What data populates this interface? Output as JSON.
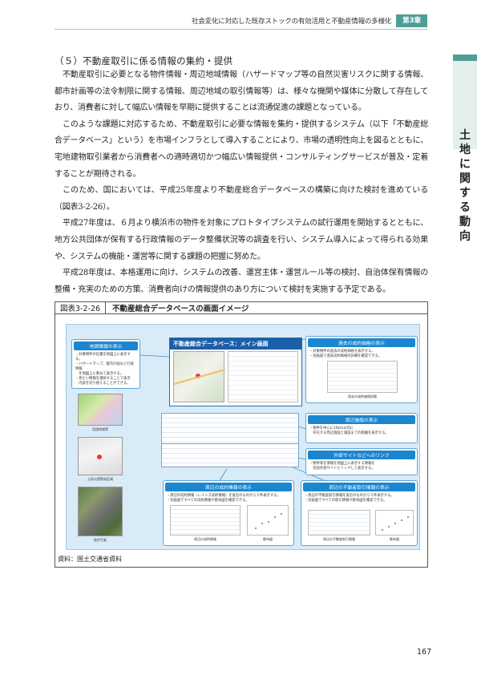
{
  "header": {
    "running_title": "社会変化に対応した既存ストックの有効活用と不動産情報の多様化",
    "chapter": "第3章"
  },
  "side_tab": {
    "chars": [
      "土",
      "地",
      "に",
      "関",
      "す",
      "る",
      "動",
      "向"
    ]
  },
  "section": {
    "title": "（５）不動産取引に係る情報の集約・提供",
    "paragraphs": [
      "不動産取引に必要となる物件情報・周辺地域情報（ハザードマップ等の自然災害リスクに関する情報、都市計画等の法令制限に関する情報、周辺地域の取引情報等）は、様々な機関や媒体に分散して存在しており、消費者に対して幅広い情報を早期に提供することは流通促進の課題となっている。",
      "このような課題に対応するため、不動産取引に必要な情報を集約・提供するシステム（以下「不動産総合データベース」という）を市場インフラとして導入することにより、市場の透明性向上を図るとともに、宅地建物取引業者から消費者への適時適切かつ幅広い情報提供・コンサルティングサービスが普及・定着することが期待される。",
      "このため、国においては、平成25年度より不動産総合データベースの構築に向けた検討を進めている（図表3-2-26）。",
      "平成27年度は、６月より横浜市の物件を対象にプロトタイプシステムの試行運用を開始するとともに、地方公共団体が保有する行政情報のデータ整備状況等の調査を行い、システム導入によって得られる効果や、システムの機能・運営等に関する課題の把握に努めた。",
      "平成28年度は、本格運用に向け、システムの改善、運営主体・運営ルール等の検討、自治体保有情報の整備・充実のための方策、消費者向けの情報提供のあり方について検討を実施する予定である。"
    ]
  },
  "figure": {
    "number": "図表3-2-26",
    "caption": "不動産総合データベースの画面イメージ",
    "source": "資料：国土交通省資料",
    "main_screen_title": "不動産総合データベース：メイン画面",
    "callouts": {
      "map_info": {
        "title": "地図情報の表示",
        "body": [
          "・対象物件の位置を地図上に表示する。",
          "・ハザードマップ、都市計画など行政情報",
          "　を地図上に重ねて表示する。",
          "・見たい情報を選択することで表示",
          "　内容を切り替えることができる。"
        ]
      },
      "past_price": {
        "title": "過去の成約価格の表示",
        "body": [
          "・対象物件の過去の成約価格を表示する。",
          "・別画面で過去成約価格の詳細を確認できる。"
        ]
      },
      "facilities": {
        "title": "周辺施設の表示",
        "body": [
          "・物件を中心に10km以内に",
          "　存在する周辺施設と施設までの距離を表示する。"
        ]
      },
      "external_links": {
        "title": "外部サイトなどへのリンク",
        "body": [
          "・物件等を情報を地図上に表示する情報を",
          "　別途外部サイトとリンクして表示する。"
        ]
      },
      "nearby_sales": {
        "title": "周辺の成約情報の表示",
        "body": [
          "・周辺の成約情報（レインズ成約情報）を直近のものから５件表示する。",
          "・別画面ですべての成約情報や散布図を確認できる。"
        ]
      },
      "nearby_transactions": {
        "title": "周辺の不動産取引情報の表示",
        "body": [
          "・周辺の不動産取引情報を直近のものから５件表示する。",
          "・別画面ですべての取引情報や散布図を確認できる。"
        ]
      }
    },
    "image_captions": {
      "hazard": "用途地域等",
      "landslide": "土砂災害警戒区域",
      "past_detail": "過去の成約価格詳細",
      "sales_detail": "周辺の成約情報",
      "scatter1": "散布図",
      "transactions_detail": "周辺の不動産取引情報",
      "scatter2": "散布図",
      "aerial": "航空写真"
    }
  },
  "page_number": "167",
  "colors": {
    "accent": "#4e9e96",
    "diagram_bg": "#d8ebf7",
    "callout_title": "#1b86cf",
    "main_screen_title": "#1b5fa8"
  }
}
